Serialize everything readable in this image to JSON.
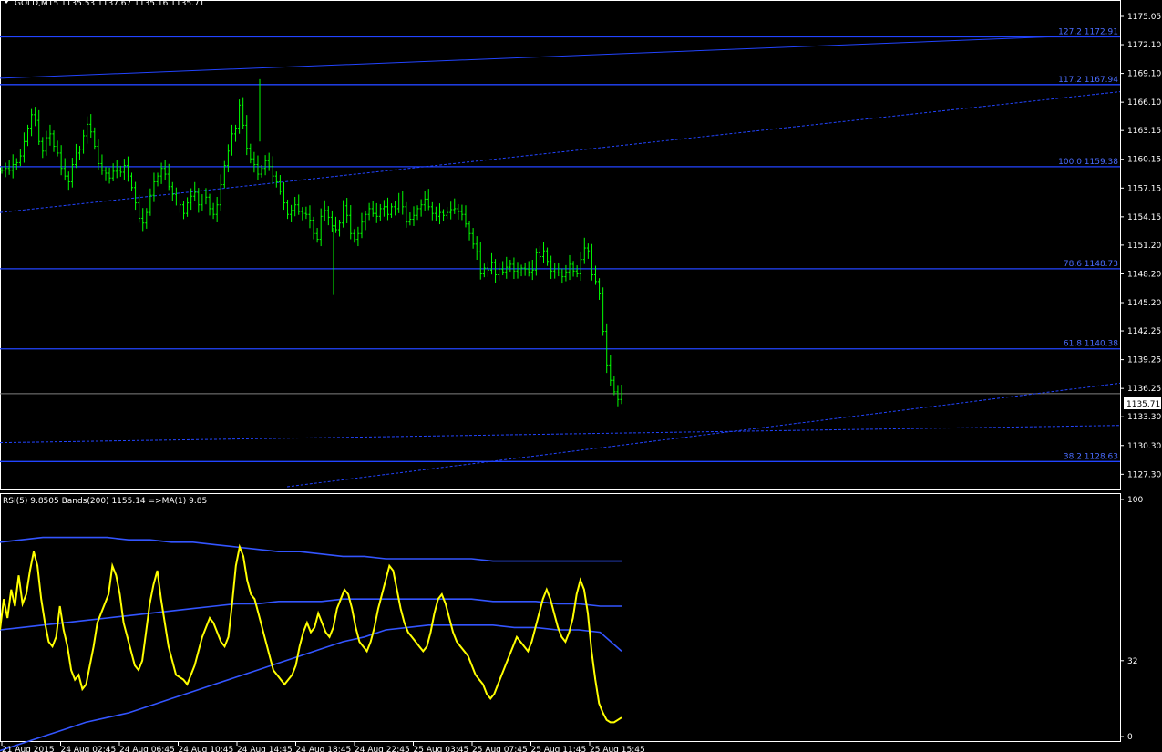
{
  "header": {
    "main_title": "GOLD,M15  1135.53 1137.67 1135.16 1135.71",
    "sub_title": "RSI(5) 9.8505  Bands(200) 1155.14  =>MA(1) 9.85"
  },
  "colors": {
    "background": "#000000",
    "axis": "#ffffff",
    "candle": "#00ff00",
    "fib_line": "#2244ff",
    "trend_line": "#2244ff",
    "price_line": "#808080",
    "rsi": "#ffff00",
    "bands": "#3355ff"
  },
  "chart_data": [
    {
      "type": "candlestick",
      "symbol": "GOLD",
      "timeframe": "M15",
      "ylim": [
        1126.0,
        1176.0
      ],
      "y_ticks": [
        "1175.05",
        "1172.10",
        "1169.10",
        "1166.10",
        "1163.15",
        "1160.15",
        "1157.15",
        "1154.15",
        "1151.20",
        "1148.20",
        "1145.20",
        "1142.25",
        "1139.25",
        "1136.25",
        "1133.30",
        "1130.30",
        "1127.30"
      ],
      "current_price": "1135.71",
      "fib_levels": [
        {
          "label": "127.2 1172.91",
          "price": 1172.91
        },
        {
          "label": "117.2 1167.94",
          "price": 1167.94
        },
        {
          "label": "100.0   1159.38",
          "price": 1159.38
        },
        {
          "label": "78.6 1148.73",
          "price": 1148.73
        },
        {
          "label": "61.8 1140.38",
          "price": 1140.38
        },
        {
          "label": "38.2 1128.63",
          "price": 1128.63
        }
      ],
      "close": [
        1159.0,
        1159.2,
        1159.0,
        1159.6,
        1159.8,
        1160.5,
        1162.0,
        1163.4,
        1164.8,
        1164.2,
        1162.0,
        1161.0,
        1162.4,
        1162.8,
        1161.5,
        1160.8,
        1159.2,
        1158.4,
        1157.8,
        1159.6,
        1160.8,
        1161.2,
        1162.6,
        1163.8,
        1163.0,
        1161.5,
        1159.7,
        1159.0,
        1158.7,
        1158.2,
        1158.9,
        1159.0,
        1158.8,
        1159.5,
        1158.4,
        1157.2,
        1155.6,
        1154.0,
        1153.5,
        1154.6,
        1156.4,
        1157.8,
        1158.4,
        1159.2,
        1158.6,
        1157.3,
        1156.5,
        1155.8,
        1155.4,
        1154.5,
        1155.6,
        1156.3,
        1156.7,
        1155.4,
        1155.8,
        1156.2,
        1155.0,
        1154.4,
        1155.4,
        1157.5,
        1159.5,
        1161.0,
        1162.8,
        1163.4,
        1165.8,
        1163.7,
        1161.3,
        1160.2,
        1159.6,
        1158.6,
        1159.2,
        1160.0,
        1159.4,
        1158.4,
        1157.8,
        1156.8,
        1155.6,
        1154.4,
        1154.8,
        1155.4,
        1154.7,
        1154.5,
        1154.4,
        1153.8,
        1152.4,
        1151.8,
        1154.2,
        1154.8,
        1154.1,
        1153.2,
        1152.8,
        1153.5,
        1155.3,
        1154.3,
        1152.4,
        1151.8,
        1152.4,
        1153.6,
        1154.4,
        1155.0,
        1154.5,
        1154.2,
        1155.0,
        1155.2,
        1154.4,
        1155.2,
        1155.0,
        1155.8,
        1155.2,
        1153.6,
        1153.9,
        1154.3,
        1155.0,
        1155.4,
        1156.0,
        1155.2,
        1154.5,
        1154.2,
        1154.6,
        1154.3,
        1154.6,
        1154.9,
        1155.0,
        1154.7,
        1154.4,
        1153.4,
        1152.4,
        1151.3,
        1150.5,
        1148.2,
        1148.8,
        1148.6,
        1149.4,
        1148.1,
        1148.7,
        1148.4,
        1148.9,
        1149.2,
        1148.5,
        1148.3,
        1148.8,
        1148.7,
        1148.4,
        1148.6,
        1150.4,
        1150.0,
        1150.6,
        1149.5,
        1148.5,
        1148.3,
        1148.3,
        1147.9,
        1148.4,
        1149.2,
        1148.5,
        1148.2,
        1149.7,
        1150.9,
        1150.6,
        1148.1,
        1147.4,
        1146.2,
        1142.2,
        1138.7,
        1137.1,
        1135.9,
        1135.1,
        1135.7
      ],
      "x_labels": [
        "21 Aug 2015",
        "24 Aug 02:45",
        "24 Aug 06:45",
        "24 Aug 10:45",
        "24 Aug 14:45",
        "24 Aug 18:45",
        "24 Aug 22:45",
        "25 Aug 03:45",
        "25 Aug 07:45",
        "25 Aug 11:45",
        "25 Aug 15:45"
      ]
    },
    {
      "type": "line",
      "name": "RSI(5)",
      "ylim": [
        0,
        100
      ],
      "y_ticks": [
        "100",
        "32",
        "0"
      ],
      "series": [
        {
          "name": "RSI(5)",
          "values": [
            45,
            58,
            50,
            62,
            55,
            68,
            56,
            60,
            70,
            78,
            72,
            58,
            48,
            40,
            38,
            42,
            55,
            45,
            38,
            28,
            24,
            26,
            20,
            22,
            30,
            38,
            48,
            52,
            56,
            60,
            72,
            68,
            60,
            48,
            42,
            36,
            30,
            28,
            32,
            44,
            56,
            64,
            70,
            58,
            48,
            38,
            32,
            26,
            25,
            24,
            22,
            26,
            30,
            36,
            42,
            46,
            50,
            48,
            44,
            40,
            38,
            42,
            56,
            72,
            80,
            76,
            66,
            60,
            58,
            52,
            46,
            40,
            34,
            28,
            26,
            24,
            22,
            24,
            26,
            30,
            38,
            44,
            48,
            44,
            46,
            52,
            48,
            44,
            42,
            46,
            54,
            58,
            62,
            60,
            54,
            46,
            40,
            38,
            36,
            40,
            46,
            54,
            60,
            66,
            72,
            70,
            62,
            54,
            48,
            44,
            42,
            40,
            38,
            36,
            38,
            44,
            52,
            58,
            60,
            56,
            50,
            44,
            40,
            38,
            36,
            34,
            30,
            26,
            24,
            22,
            18,
            16,
            18,
            22,
            26,
            30,
            34,
            38,
            42,
            40,
            38,
            36,
            40,
            46,
            52,
            58,
            62,
            58,
            52,
            46,
            42,
            40,
            44,
            50,
            60,
            66,
            62,
            52,
            36,
            24,
            14,
            10,
            7,
            6,
            6,
            7,
            8
          ]
        },
        {
          "name": "Bands upper",
          "values": [
            82,
            83,
            84,
            84,
            84,
            84,
            83,
            83,
            82,
            82,
            81,
            80,
            79,
            78,
            78,
            77,
            76,
            76,
            75,
            75,
            75,
            75,
            75,
            74,
            74,
            74,
            74,
            74,
            74,
            74
          ]
        },
        {
          "name": "Bands middle",
          "values": [
            45,
            46,
            47,
            48,
            49,
            50,
            51,
            52,
            53,
            54,
            55,
            56,
            56,
            57,
            57,
            57,
            58,
            58,
            58,
            58,
            58,
            58,
            58,
            57,
            57,
            57,
            56,
            56,
            55,
            55
          ]
        },
        {
          "name": "Bands lower",
          "values": [
            -6,
            -3,
            0,
            3,
            6,
            8,
            10,
            13,
            16,
            19,
            22,
            25,
            28,
            31,
            34,
            37,
            40,
            42,
            45,
            46,
            47,
            47,
            47,
            47,
            46,
            46,
            45,
            45,
            44,
            36
          ]
        }
      ]
    }
  ]
}
